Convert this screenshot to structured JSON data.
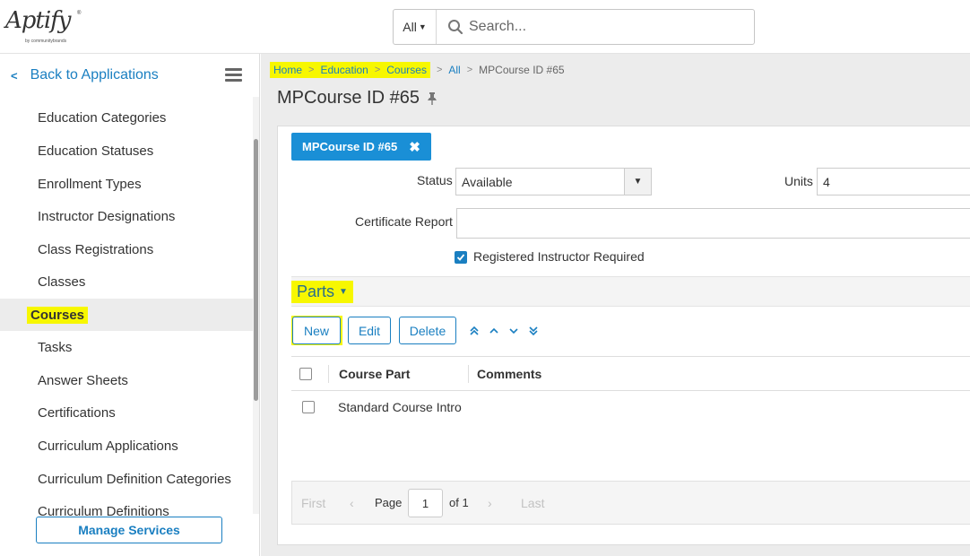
{
  "header": {
    "logo_text": "Aptify",
    "logo_tm": "®",
    "logo_sub": "by communitybrands",
    "search_scope": "All",
    "search_placeholder": "Search..."
  },
  "sidebar": {
    "back_label": "Back to Applications",
    "items": [
      {
        "label": "Education Categories"
      },
      {
        "label": "Education Statuses"
      },
      {
        "label": "Enrollment Types"
      },
      {
        "label": "Instructor Designations"
      },
      {
        "label": "Class Registrations"
      },
      {
        "label": "Classes"
      },
      {
        "label": "Courses",
        "active": true
      },
      {
        "label": "Tasks"
      },
      {
        "label": "Answer Sheets"
      },
      {
        "label": "Certifications"
      },
      {
        "label": "Curriculum Applications"
      },
      {
        "label": "Curriculum Definition Categories"
      },
      {
        "label": "Curriculum Definitions"
      }
    ],
    "manage_services": "Manage Services"
  },
  "breadcrumb": {
    "items": [
      "Home",
      "Education",
      "Courses",
      "All"
    ],
    "current": "MPCourse ID #65"
  },
  "page": {
    "title": "MPCourse ID #65"
  },
  "record": {
    "tab_label": "MPCourse ID #65",
    "status_label": "Status",
    "status_value": "Available",
    "units_label": "Units",
    "units_value": "4",
    "certificate_label": "Certificate Report",
    "certificate_value": "",
    "instructor_required_label": "Registered Instructor Required",
    "instructor_required": true
  },
  "parts": {
    "title": "Parts",
    "buttons": {
      "new": "New",
      "edit": "Edit",
      "delete": "Delete"
    },
    "columns": [
      "Course Part",
      "Comments"
    ],
    "rows": [
      {
        "course_part": "Standard Course Intro",
        "comments": ""
      }
    ],
    "pager": {
      "first": "First",
      "prev": "‹",
      "page_label": "Page",
      "page_value": "1",
      "of_label": "of 1",
      "next": "›",
      "last": "Last"
    }
  },
  "colors": {
    "accent": "#1a7fc1",
    "highlight": "#f7f700",
    "tab_bg": "#1a8fd6"
  }
}
